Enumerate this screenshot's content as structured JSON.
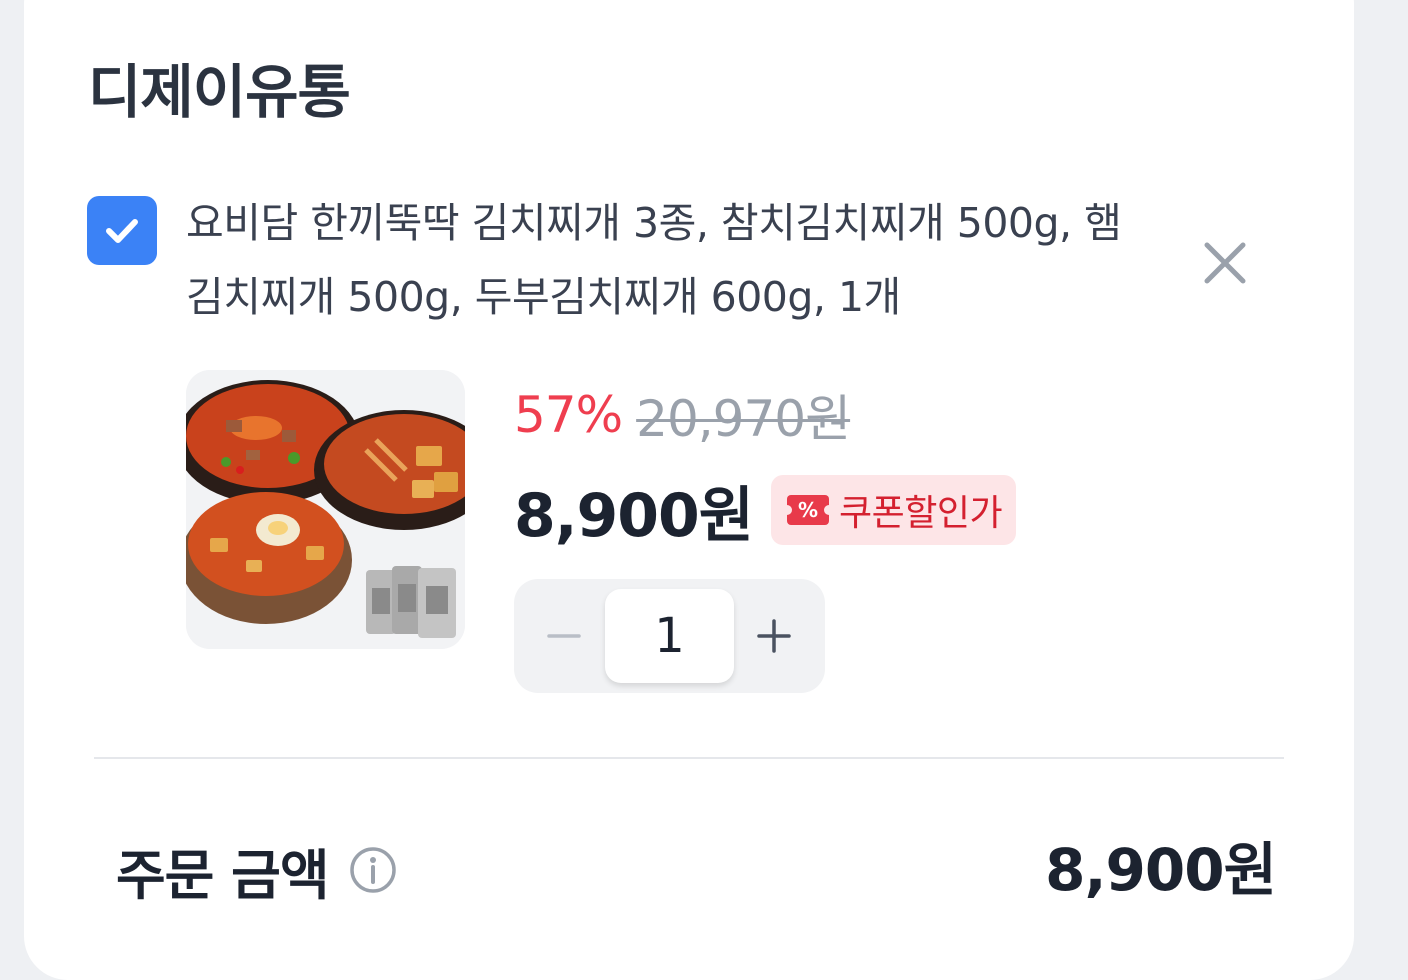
{
  "seller": {
    "name": "디제이유통"
  },
  "item": {
    "selected": true,
    "name": "요비담 한끼뚝딱 김치찌개 3종, 참치김치찌개 500g, 햄김치찌개 500g, 두부김치찌개 600g, 1개",
    "discount_rate": "57%",
    "original_price": "20,970원",
    "sale_price": "8,900원",
    "coupon_badge": {
      "icon": "coupon-percent-icon",
      "icon_glyph": "%",
      "label": "쿠폰할인가"
    },
    "quantity": "1",
    "remove_icon": "close-icon"
  },
  "summary": {
    "label": "주문 금액",
    "info_icon": "info-icon",
    "amount": "8,900원"
  },
  "colors": {
    "accent": "#3b82f6",
    "discount": "#ef3e4f",
    "coupon_text": "#d4202f",
    "coupon_bg": "#fde5e7",
    "text_primary": "#1c2330",
    "text_muted": "#9aa1ab"
  }
}
